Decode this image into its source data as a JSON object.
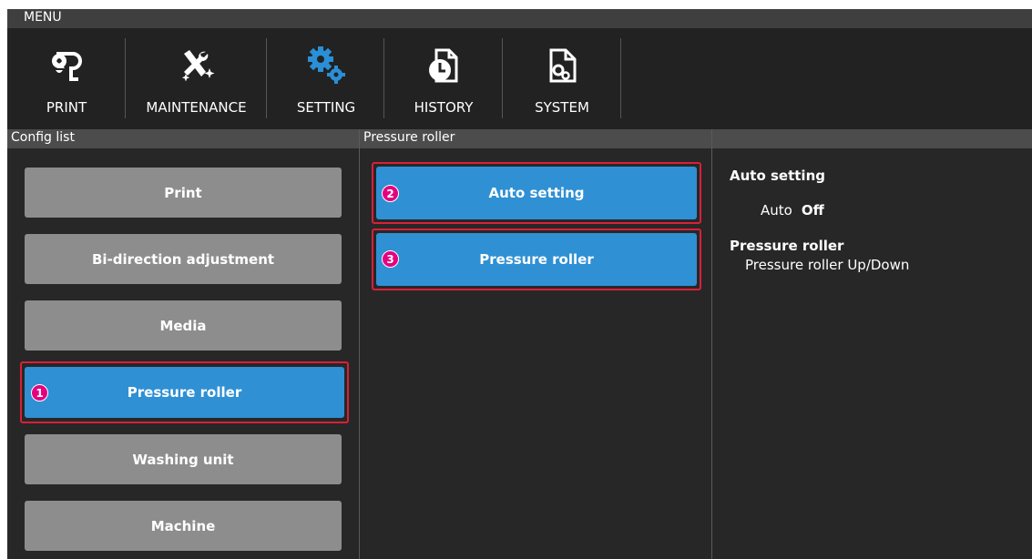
{
  "menu_title": "MENU",
  "toolbar": {
    "print": {
      "label": "PRINT",
      "icon": "print-roll-icon"
    },
    "maintenance": {
      "label": "MAINTENANCE",
      "icon": "tools-sparkle-icon"
    },
    "setting": {
      "label": "SETTING",
      "icon": "gears-icon"
    },
    "history": {
      "label": "HISTORY",
      "icon": "clock-document-icon"
    },
    "system": {
      "label": "SYSTEM",
      "icon": "gear-document-icon"
    }
  },
  "config_list": {
    "header": "Config list",
    "items": [
      {
        "label": "Print"
      },
      {
        "label": "Bi-direction adjustment"
      },
      {
        "label": "Media"
      },
      {
        "label": "Pressure roller"
      },
      {
        "label": "Washing unit"
      },
      {
        "label": "Machine"
      }
    ]
  },
  "middle": {
    "header": "Pressure roller",
    "items": [
      {
        "label": "Auto setting"
      },
      {
        "label": "Pressure roller"
      }
    ]
  },
  "info": {
    "auto_title": "Auto setting",
    "auto_key": "Auto",
    "auto_value": "Off",
    "roller_title": "Pressure roller",
    "roller_desc": "Pressure roller Up/Down"
  },
  "badges": [
    "1",
    "2",
    "3"
  ],
  "colors": {
    "accent_blue": "#2f90d4",
    "accent_setting_icon": "#2a8fd6",
    "grey_button": "#8d8d8d",
    "highlight_red": "#d8203a",
    "badge_magenta": "#e4007f",
    "background": "#272727"
  }
}
